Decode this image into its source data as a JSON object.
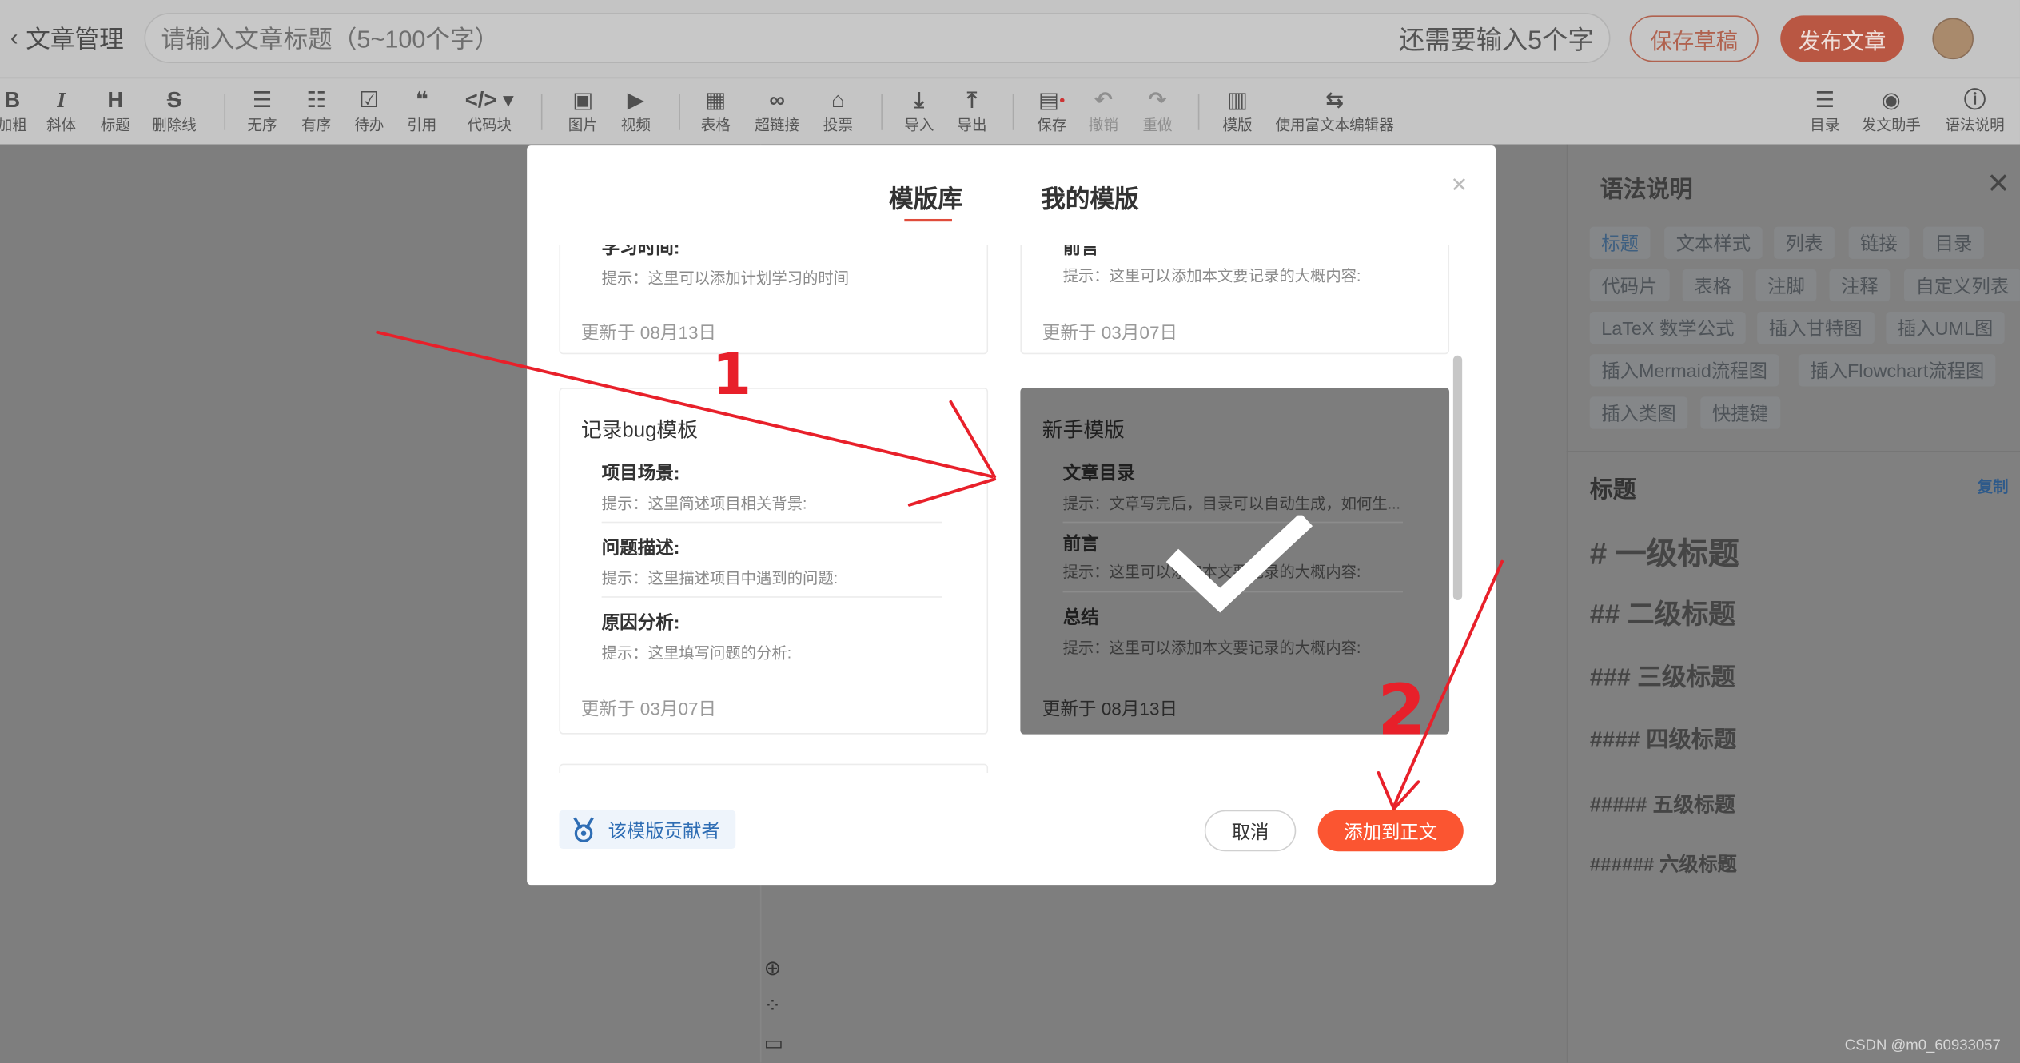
{
  "header": {
    "back_label": "文章管理",
    "title_placeholder": "请输入文章标题（5~100个字）",
    "remaining_hint": "还需要输入5个字",
    "save_draft": "保存草稿",
    "publish": "发布文章"
  },
  "toolbar": {
    "bold": "加粗",
    "italic": "斜体",
    "heading": "标题",
    "strike": "删除线",
    "unordered": "无序",
    "ordered": "有序",
    "todo": "待办",
    "quote": "引用",
    "code": "代码块",
    "image": "图片",
    "video": "视频",
    "table": "表格",
    "link": "超链接",
    "vote": "投票",
    "import": "导入",
    "export": "导出",
    "save": "保存",
    "undo": "撤销",
    "redo": "重做",
    "template": "模版",
    "rich_editor": "使用富文本编辑器",
    "toc": "目录",
    "assistant": "发文助手",
    "syntax": "语法说明"
  },
  "syntax_panel": {
    "title": "语法说明",
    "tags": [
      "标题",
      "文本样式",
      "列表",
      "链接",
      "目录",
      "代码片",
      "表格",
      "注脚",
      "注释",
      "自定义列表",
      "LaTeX 数学公式",
      "插入甘特图",
      "插入UML图",
      "插入Mermaid流程图",
      "插入Flowchart流程图",
      "插入类图",
      "快捷键"
    ],
    "section_title": "标题",
    "copy": "复制",
    "headings": [
      "# 一级标题",
      "## 二级标题",
      "### 三级标题",
      "#### 四级标题",
      "##### 五级标题",
      "###### 六级标题"
    ]
  },
  "modal": {
    "tab_library": "模版库",
    "tab_mine": "我的模版",
    "cards": [
      {
        "partial_item": "学习时间:",
        "hint": "提示：这里可以添加计划学习的时间",
        "updated": "更新于 08月13日"
      },
      {
        "partial_item": "前言",
        "hint": "提示：这里可以添加本文要记录的大概内容:",
        "updated": "更新于 03月07日"
      },
      {
        "title": "记录bug模板",
        "items": [
          {
            "label": "项目场景:",
            "hint": "提示：这里简述项目相关背景:"
          },
          {
            "label": "问题描述:",
            "hint": "提示：这里描述项目中遇到的问题:"
          },
          {
            "label": "原因分析:",
            "hint": "提示：这里填写问题的分析:"
          }
        ],
        "updated": "更新于 03月07日"
      },
      {
        "title": "新手模版",
        "items": [
          {
            "label": "文章目录",
            "hint": "提示：文章写完后，目录可以自动生成，如何生..."
          },
          {
            "label": "前言",
            "hint": "提示：这里可以添加本文要记录的大概内容:"
          },
          {
            "label": "总结",
            "hint": "提示：这里可以添加本文要记录的大概内容:"
          }
        ],
        "updated": "更新于 08月13日",
        "selected": true
      }
    ],
    "contributor": "该模版贡献者",
    "cancel": "取消",
    "add_to_body": "添加到正文"
  },
  "annotations": {
    "mark1": "1",
    "mark2": "2",
    "color": "#e8202a"
  },
  "watermark": "CSDN @m0_60933057"
}
